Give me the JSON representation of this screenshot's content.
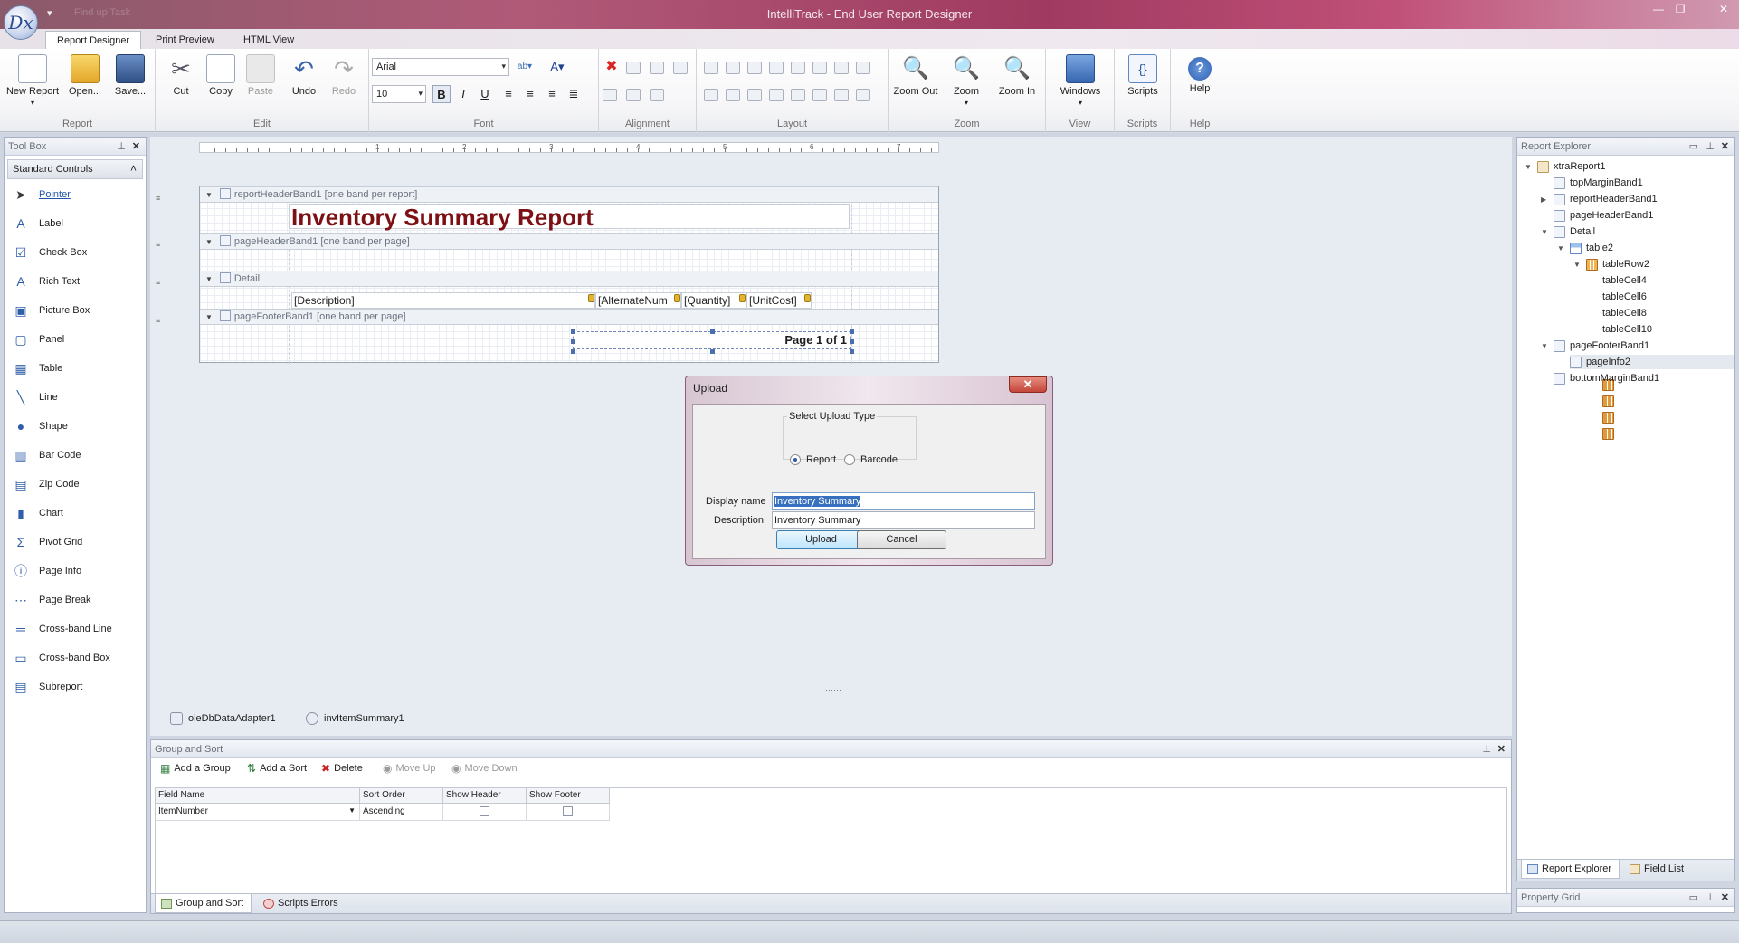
{
  "window": {
    "title": "IntelliTrack - End User Report Designer",
    "qat_text": "Find up Task"
  },
  "ribbon_tabs": [
    "Report Designer",
    "Print Preview",
    "HTML View"
  ],
  "ribbon": {
    "report": {
      "label": "Report",
      "new": "New Report",
      "open": "Open...",
      "save": "Save..."
    },
    "edit": {
      "label": "Edit",
      "cut": "Cut",
      "copy": "Copy",
      "paste": "Paste",
      "undo": "Undo",
      "redo": "Redo"
    },
    "font": {
      "label": "Font",
      "family": "Arial",
      "size": "10",
      "bold": "B",
      "italic": "I",
      "underline": "U"
    },
    "alignment": {
      "label": "Alignment"
    },
    "layout": {
      "label": "Layout"
    },
    "zoom": {
      "label": "Zoom",
      "zoom_out": "Zoom Out",
      "zoom": "Zoom",
      "zoom_in": "Zoom In"
    },
    "view": {
      "label": "View",
      "windows": "Windows"
    },
    "scripts": {
      "label": "Scripts",
      "scripts": "Scripts"
    },
    "help": {
      "label": "Help",
      "help": "Help"
    }
  },
  "toolbox": {
    "title": "Tool Box",
    "category": "Standard Controls",
    "items": [
      {
        "label": "Pointer",
        "icon": "pointer-icon"
      },
      {
        "label": "Label",
        "icon": "label-icon"
      },
      {
        "label": "Check Box",
        "icon": "checkbox-icon"
      },
      {
        "label": "Rich Text",
        "icon": "richtext-icon"
      },
      {
        "label": "Picture Box",
        "icon": "picture-icon"
      },
      {
        "label": "Panel",
        "icon": "panel-icon"
      },
      {
        "label": "Table",
        "icon": "table-icon"
      },
      {
        "label": "Line",
        "icon": "line-icon"
      },
      {
        "label": "Shape",
        "icon": "shape-icon"
      },
      {
        "label": "Bar Code",
        "icon": "barcode-icon"
      },
      {
        "label": "Zip Code",
        "icon": "zipcode-icon"
      },
      {
        "label": "Chart",
        "icon": "chart-icon"
      },
      {
        "label": "Pivot Grid",
        "icon": "pivot-icon"
      },
      {
        "label": "Page Info",
        "icon": "pageinfo-icon"
      },
      {
        "label": "Page Break",
        "icon": "pagebreak-icon"
      },
      {
        "label": "Cross-band Line",
        "icon": "crossband-line-icon"
      },
      {
        "label": "Cross-band Box",
        "icon": "crossband-box-icon"
      },
      {
        "label": "Subreport",
        "icon": "subreport-icon"
      }
    ]
  },
  "report": {
    "bands": {
      "report_header": "reportHeaderBand1 [one band per report]",
      "page_header": "pageHeaderBand1 [one band per page]",
      "detail": "Detail",
      "page_footer": "pageFooterBand1 [one band per page]"
    },
    "title": "Inventory Summary Report",
    "cells": [
      "[Description]",
      "[AlternateNum",
      "[Quantity]",
      "[UnitCost]"
    ],
    "page_info": "Page 1 of 1",
    "ruler": [
      "1",
      "2",
      "3",
      "4",
      "5",
      "6",
      "7"
    ]
  },
  "tray": [
    "oleDbDataAdapter1",
    "invItemSummary1"
  ],
  "dialog": {
    "title": "Upload",
    "group": "Select Upload Type",
    "option_report": "Report",
    "option_barcode": "Barcode",
    "display_name_label": "Display name",
    "display_name_value": "Inventory Summary",
    "description_label": "Description",
    "description_value": "Inventory Summary",
    "upload": "Upload",
    "cancel": "Cancel"
  },
  "group_sort": {
    "title": "Group and Sort",
    "toolbar": {
      "add_group": "Add a Group",
      "add_sort": "Add a Sort",
      "delete": "Delete",
      "move_up": "Move Up",
      "move_down": "Move Down"
    },
    "columns": [
      "Field Name",
      "Sort Order",
      "Show Header",
      "Show Footer"
    ],
    "row": {
      "field": "ItemNumber",
      "order": "Ascending"
    },
    "tabs": [
      "Group and Sort",
      "Scripts Errors"
    ]
  },
  "explorer": {
    "title": "Report Explorer",
    "nodes": [
      "xtraReport1",
      "topMarginBand1",
      "reportHeaderBand1",
      "pageHeaderBand1",
      "Detail",
      "table2",
      "tableRow2",
      "tableCell4",
      "tableCell6",
      "tableCell8",
      "tableCell10",
      "pageFooterBand1",
      "pageInfo2",
      "bottomMarginBand1"
    ],
    "tabs": [
      "Report Explorer",
      "Field List"
    ]
  },
  "property_grid": {
    "title": "Property Grid"
  },
  "colors": {
    "accent": "#7d1014",
    "title_bar": "#a03a60",
    "selection": "#3870c0"
  }
}
